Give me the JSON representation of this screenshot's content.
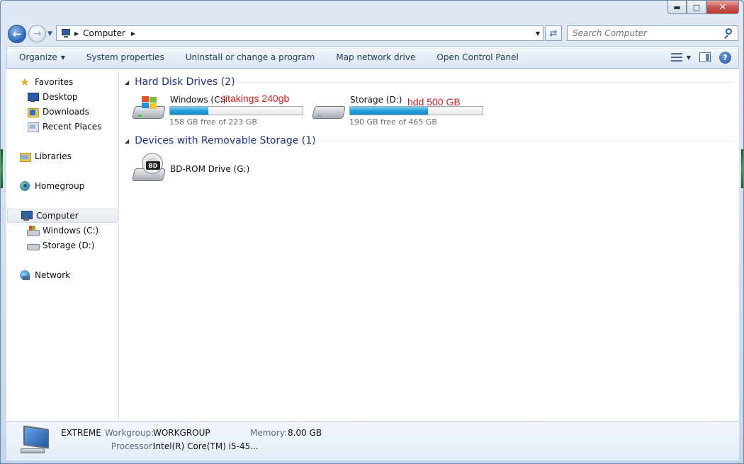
{
  "window": {
    "caption_buttons": [
      "minimize",
      "maximize",
      "close"
    ]
  },
  "nav": {
    "address_path": "Computer",
    "search_placeholder": "Search Computer"
  },
  "command_bar": {
    "organize": "Organize",
    "items": [
      "System properties",
      "Uninstall or change a program",
      "Map network drive",
      "Open Control Panel"
    ]
  },
  "sidebar": {
    "favorites": "Favorites",
    "desktop": "Desktop",
    "downloads": "Downloads",
    "recent_places": "Recent Places",
    "libraries": "Libraries",
    "homegroup": "Homegroup",
    "computer": "Computer",
    "windows_c": "Windows (C:)",
    "storage_d": "Storage (D:)",
    "network": "Network"
  },
  "content": {
    "hdd_group": "Hard Disk Drives (2)",
    "removable_group": "Devices with Removable Storage (1)",
    "drives": [
      {
        "name": "Windows (C:)",
        "free_text": "158 GB free of 223 GB",
        "used_fraction": 0.29,
        "annotation": "sitakings 240gb"
      },
      {
        "name": "Storage (D:)",
        "free_text": "190 GB free of 465 GB",
        "used_fraction": 0.59,
        "annotation": "hdd 500 GB"
      }
    ],
    "removable": [
      {
        "name": "BD-ROM Drive (G:)",
        "badge": "BD"
      }
    ]
  },
  "details": {
    "computer_name": "EXTREME",
    "workgroup_label": "Workgroup:",
    "workgroup_value": "WORKGROUP",
    "memory_label": "Memory:",
    "memory_value": "8.00 GB",
    "processor_label": "Processor:",
    "processor_value": "Intel(R) Core(TM) i5-45..."
  },
  "colors": {
    "accent": "#1e3287",
    "annotation": "#d52020",
    "bar_fill": "#26a0da"
  }
}
